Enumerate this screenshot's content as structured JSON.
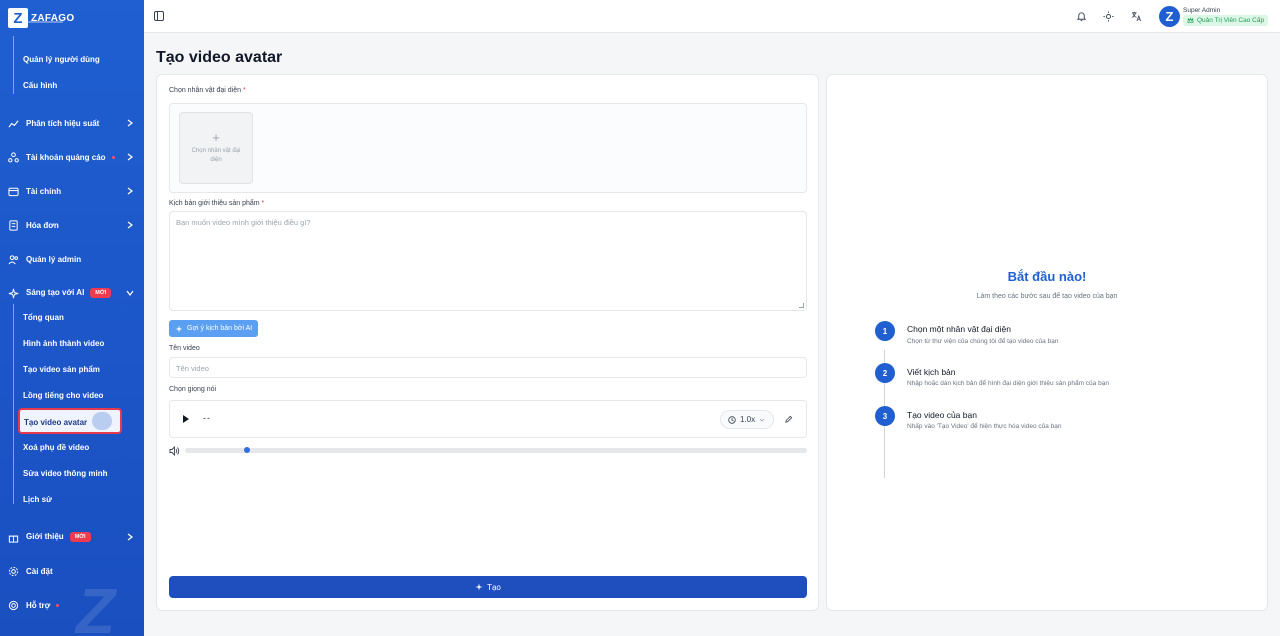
{
  "brand": {
    "name": "ZAFAGO",
    "logo_letter": "Z"
  },
  "sidebar": {
    "top_sub_items": [
      {
        "label": "Quản lý người dùng"
      },
      {
        "label": "Cấu hình"
      }
    ],
    "menu": [
      {
        "label": "Phân tích hiệu suất",
        "icon": "chart-line-icon"
      },
      {
        "label": "Tài khoản quảng cáo",
        "icon": "users-network-icon"
      },
      {
        "label": "Tài chính",
        "icon": "wallet-icon"
      },
      {
        "label": "Hóa đơn",
        "icon": "receipt-icon"
      },
      {
        "label": "Quản lý admin",
        "icon": "user-group-icon"
      },
      {
        "label": "Sáng tạo với AI",
        "icon": "sparkles-icon",
        "badge": "MỚI"
      }
    ],
    "ai_sub_items": [
      {
        "label": "Tổng quan"
      },
      {
        "label": "Hình ảnh thành video"
      },
      {
        "label": "Tạo video sản phẩm"
      },
      {
        "label": "Lồng tiếng cho video"
      },
      {
        "label": "Tạo video avatar"
      },
      {
        "label": "Xoá phụ đề video"
      },
      {
        "label": "Sửa video thông minh"
      },
      {
        "label": "Lịch sử"
      }
    ],
    "bottom_menu": [
      {
        "label": "Giới thiệu",
        "icon": "gift-icon",
        "badge": "MỚI"
      },
      {
        "label": "Cài đặt",
        "icon": "gear-icon"
      },
      {
        "label": "Hỗ trợ",
        "icon": "support-icon"
      }
    ]
  },
  "topbar": {
    "user_name": "Super Admin",
    "user_role": "Quản Trị Viên Cao Cấp"
  },
  "page": {
    "title": "Tạo video avatar"
  },
  "form": {
    "avatar_label": "Chọn nhân vật đại diện",
    "avatar_upload_text": "Chọn nhân vật đại diện",
    "script_label": "Kịch bản giới thiệu sản phẩm",
    "script_placeholder": "Bạn muốn video mình giới thiệu điều gì?",
    "ai_button": "Gợi ý kịch bản bởi AI",
    "video_name_label": "Tên video",
    "video_name_placeholder": "Tên video",
    "voice_label": "Chọn giọng nói",
    "voice_value": "--",
    "speed": "1.0x",
    "volume_level": 0.1,
    "submit": "Tạo"
  },
  "guide": {
    "title": "Bắt đầu nào!",
    "subtitle": "Làm theo các bước sau để tạo video của bạn",
    "steps": [
      {
        "num": "1",
        "title": "Chọn một nhân vật đại diện",
        "desc": "Chọn từ thư viện của chúng tôi để tạo video của bạn"
      },
      {
        "num": "2",
        "title": "Viết kịch bản",
        "desc": "Nhập hoặc dán kịch bản để hình đại diện giới thiệu sản phẩm của bạn"
      },
      {
        "num": "3",
        "title": "Tạo video của bạn",
        "desc": "Nhấp vào 'Tạo Video' để hiện thực hóa video của bạn"
      }
    ]
  },
  "colors": {
    "sidebar": "#1f5fd1",
    "accent": "#1f4fbf",
    "required": "#e53950",
    "new_badge": "#ef3b4f"
  }
}
